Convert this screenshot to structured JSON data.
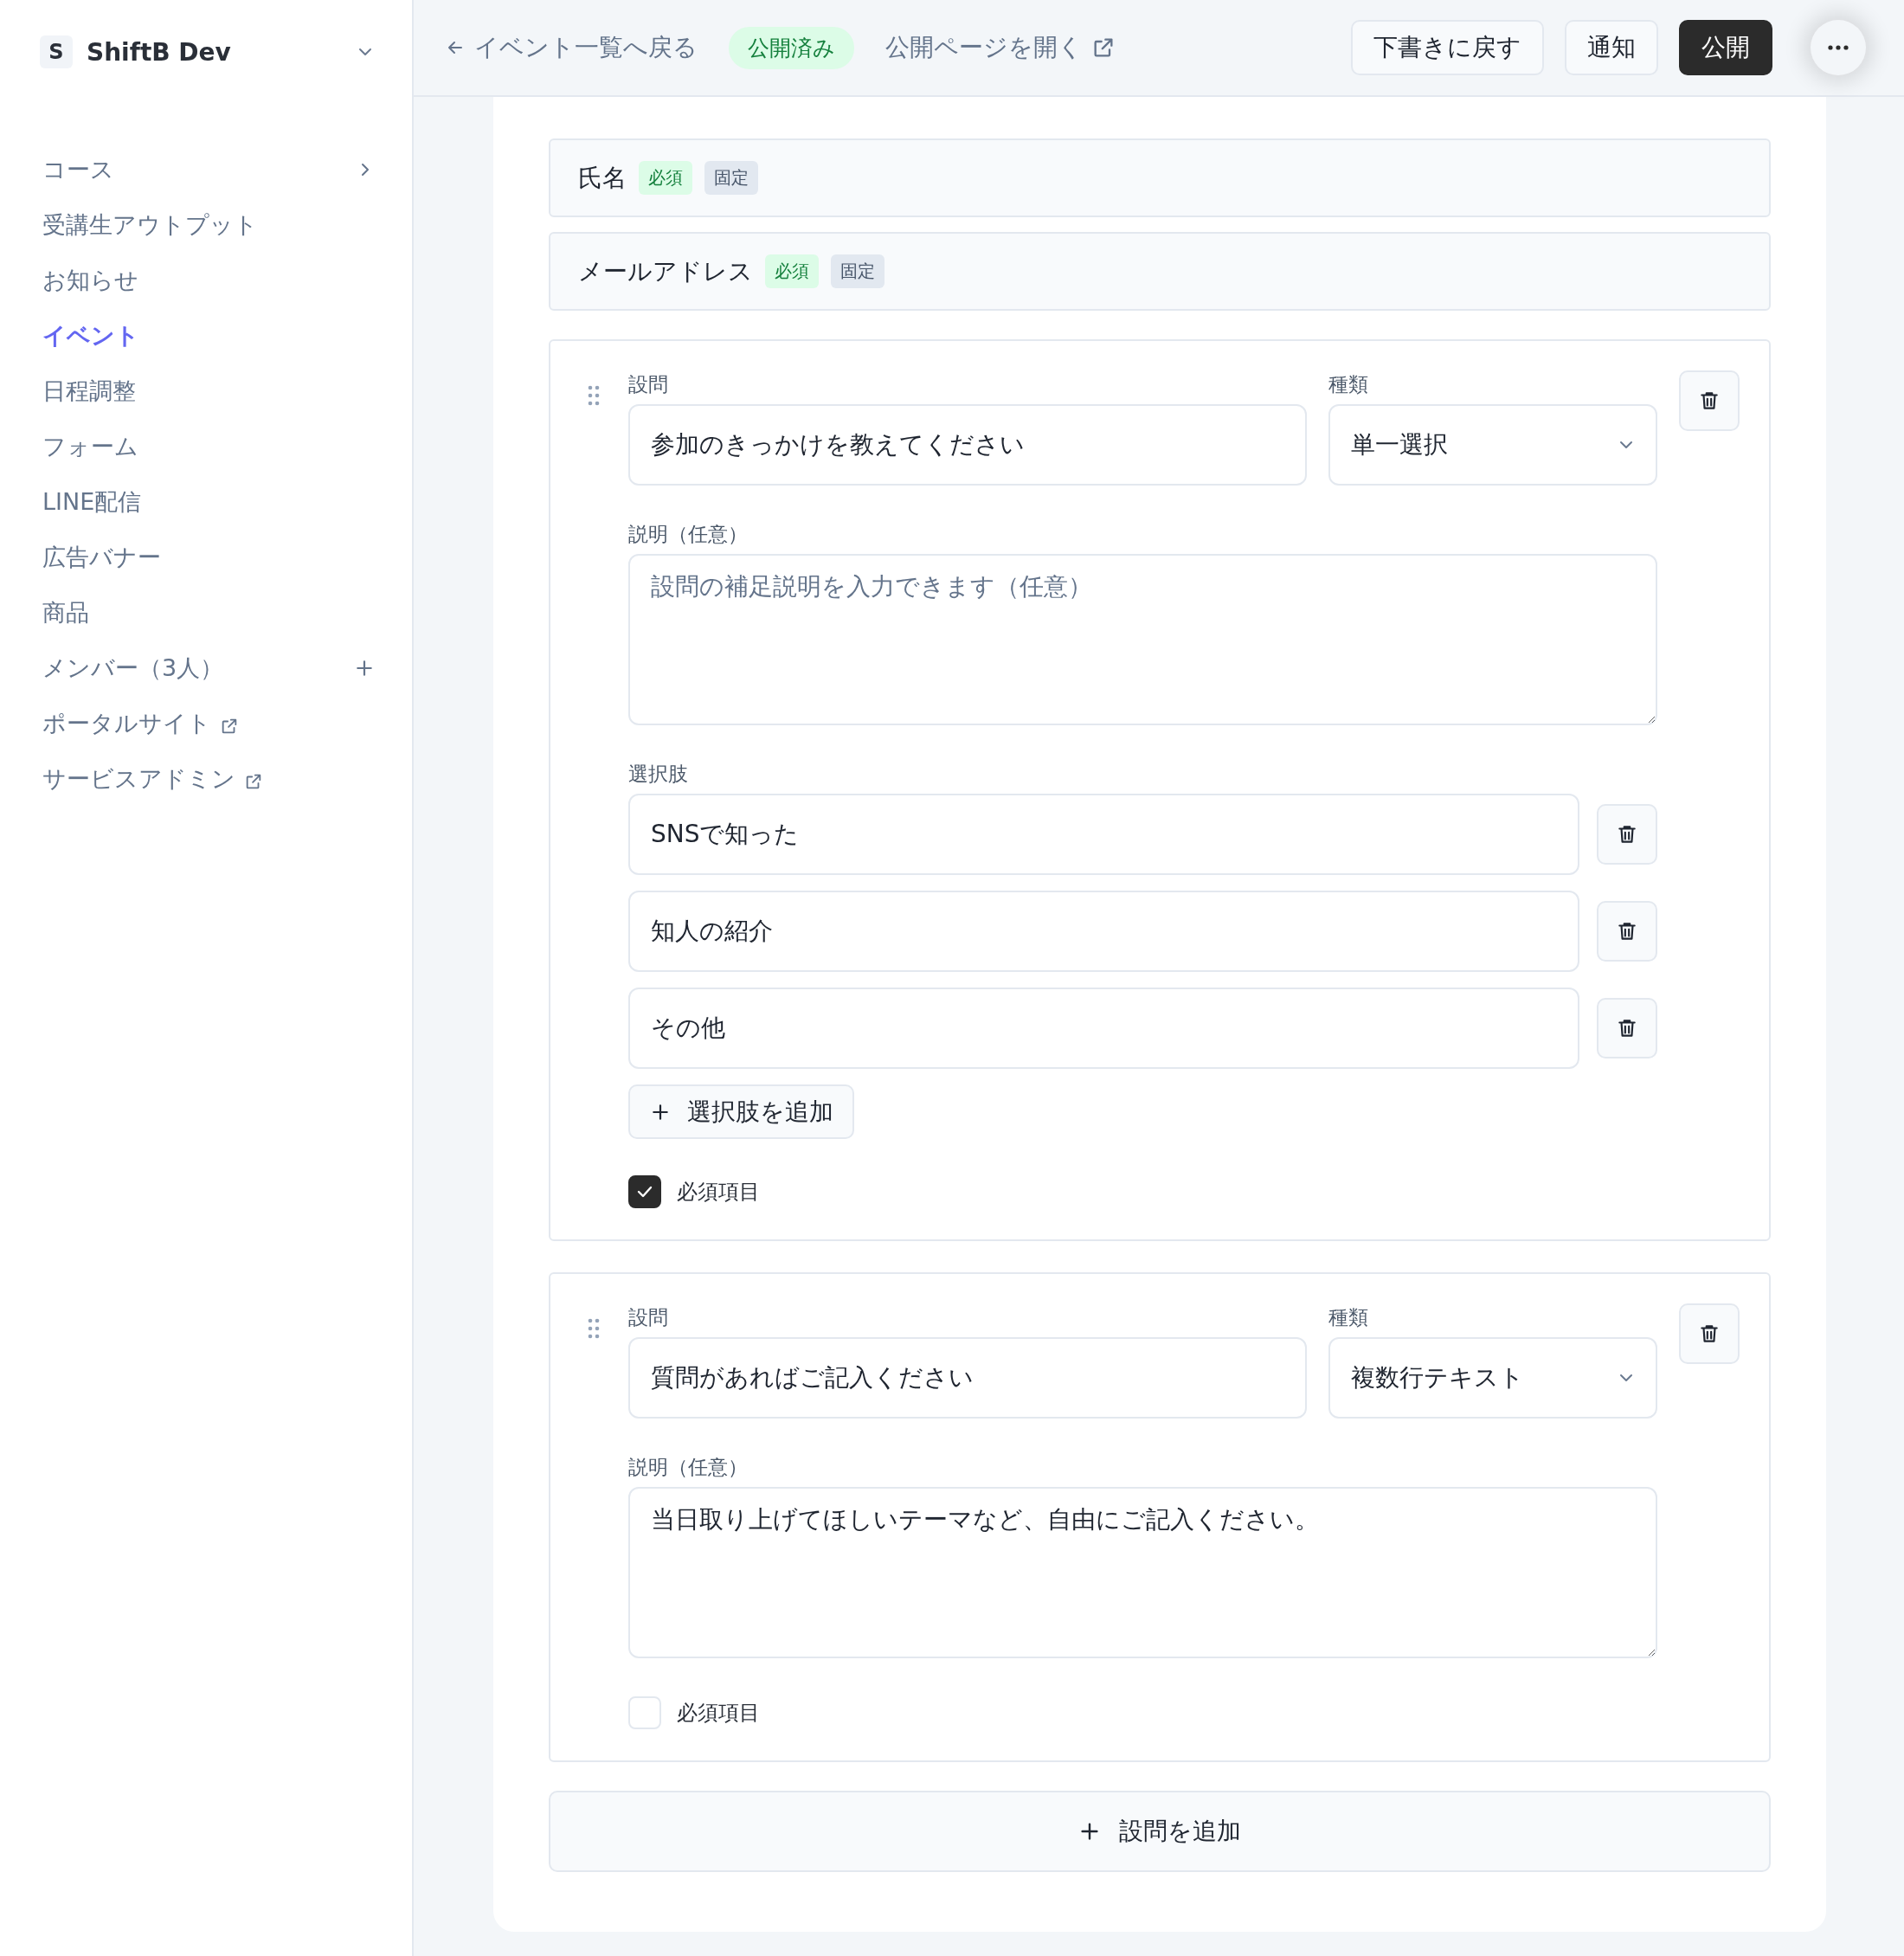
{
  "sidebar": {
    "workspace": {
      "initial": "S",
      "name": "ShiftB Dev"
    },
    "items": [
      {
        "label": "コース",
        "selected": false,
        "kind": "expand"
      },
      {
        "label": "受講生アウトプット",
        "selected": false,
        "kind": "plain"
      },
      {
        "label": "お知らせ",
        "selected": false,
        "kind": "plain"
      },
      {
        "label": "イベント",
        "selected": true,
        "kind": "plain"
      },
      {
        "label": "日程調整",
        "selected": false,
        "kind": "plain"
      },
      {
        "label": "フォーム",
        "selected": false,
        "kind": "plain"
      },
      {
        "label": "LINE配信",
        "selected": false,
        "kind": "plain"
      },
      {
        "label": "広告バナー",
        "selected": false,
        "kind": "plain"
      },
      {
        "label": "商品",
        "selected": false,
        "kind": "plain"
      },
      {
        "label": "メンバー（3人）",
        "selected": false,
        "kind": "add"
      },
      {
        "label": "ポータルサイト",
        "selected": false,
        "kind": "external"
      },
      {
        "label": "サービスアドミン",
        "selected": false,
        "kind": "external"
      }
    ]
  },
  "topbar": {
    "back_link": "イベント一覧へ戻る",
    "status_badge": "公開済み",
    "open_link": "公開ページを開く",
    "buttons": [
      {
        "label": "下書きに戻す",
        "kind": "secondary"
      },
      {
        "label": "通知",
        "kind": "secondary"
      },
      {
        "label": "公開",
        "kind": "primary"
      }
    ]
  },
  "fixed_fields": [
    {
      "label": "氏名",
      "badges": [
        {
          "label": "必須",
          "kind": "required"
        },
        {
          "label": "固定",
          "kind": "fixed"
        }
      ]
    },
    {
      "label": "メールアドレス",
      "badges": [
        {
          "label": "必須",
          "kind": "required"
        },
        {
          "label": "固定",
          "kind": "fixed"
        }
      ]
    }
  ],
  "questions": [
    {
      "question_label": "設問",
      "question": "参加のきっかけを教えてください",
      "type_label": "種類",
      "type": "単一選択",
      "description_label": "説明（任意）",
      "description": {
        "placeholder": "設問の補足説明を入力できます（任意）"
      },
      "options_label": "選択肢",
      "options": [
        "SNSで知った",
        "知人の紹介",
        "その他"
      ],
      "add_option": "選択肢を追加",
      "required_label": "必須項目",
      "required": true
    },
    {
      "question_label": "設問",
      "question": "質問があればご記入ください",
      "type_label": "種類",
      "type": "複数行テキスト",
      "description_label": "説明（任意）",
      "description": {
        "value": "当日取り上げてほしいテーマなど、自由にご記入ください。"
      },
      "required_label": "必須項目",
      "required": false
    }
  ],
  "add_question": "設問を追加"
}
